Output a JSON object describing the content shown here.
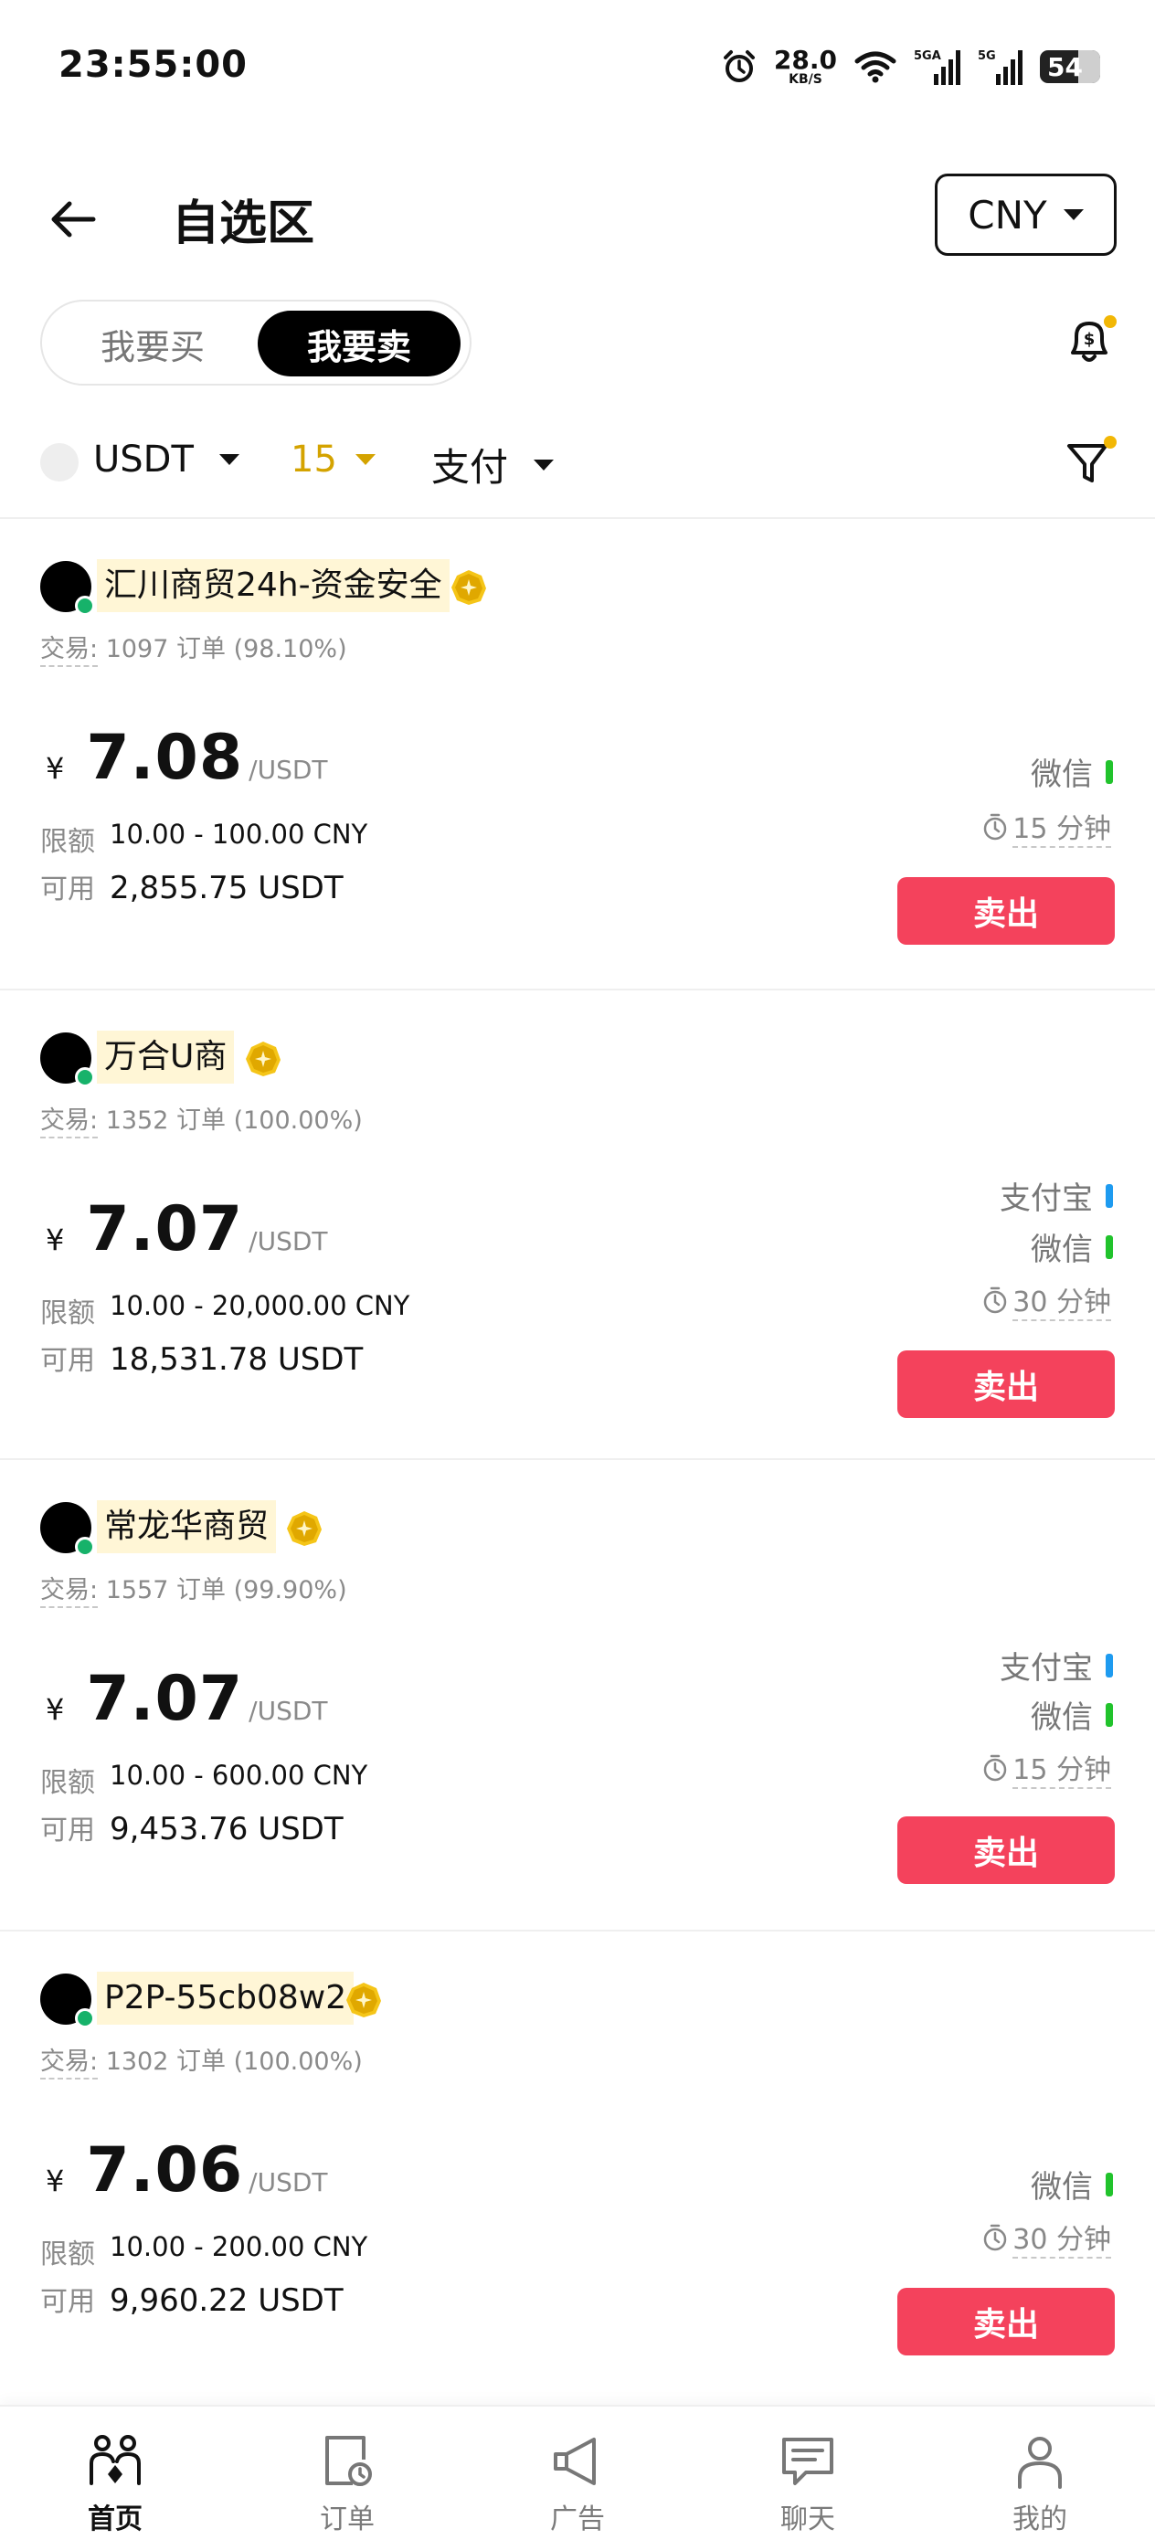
{
  "status_bar": {
    "time": "23:55:00",
    "net_speed_value": "28.0",
    "net_speed_unit": "KB/S",
    "sim1_label": "5GA",
    "sim2_label": "5G",
    "battery": "54"
  },
  "header": {
    "title": "自选区",
    "currency": "CNY"
  },
  "toggle": {
    "buy_label": "我要买",
    "sell_label": "我要卖",
    "selected": "我要卖"
  },
  "filters": {
    "coin": "USDT",
    "amount": "15",
    "payment": "支付"
  },
  "listings": [
    {
      "merchant": "汇川商贸24h-资金安全",
      "stats_label": "交易:",
      "stats_value": "1097 订单 (98.10%)",
      "yen": "¥",
      "price": "7.08",
      "unit": "/USDT",
      "limit_label": "限额",
      "limit_value": "10.00 - 100.00 CNY",
      "available_label": "可用",
      "available_value": "2,855.75 USDT",
      "payment_methods": [
        {
          "name": "微信",
          "color": "#21c32c"
        }
      ],
      "time_limit": "15 分钟",
      "action": "卖出"
    },
    {
      "merchant": "万合U商",
      "stats_label": "交易:",
      "stats_value": "1352 订单 (100.00%)",
      "yen": "¥",
      "price": "7.07",
      "unit": "/USDT",
      "limit_label": "限额",
      "limit_value": "10.00 - 20,000.00 CNY",
      "available_label": "可用",
      "available_value": "18,531.78 USDT",
      "payment_methods": [
        {
          "name": "支付宝",
          "color": "#1e9bf0"
        },
        {
          "name": "微信",
          "color": "#21c32c"
        }
      ],
      "time_limit": "30 分钟",
      "action": "卖出"
    },
    {
      "merchant": "常龙华商贸",
      "stats_label": "交易:",
      "stats_value": "1557 订单 (99.90%)",
      "yen": "¥",
      "price": "7.07",
      "unit": "/USDT",
      "limit_label": "限额",
      "limit_value": "10.00 - 600.00 CNY",
      "available_label": "可用",
      "available_value": "9,453.76 USDT",
      "payment_methods": [
        {
          "name": "支付宝",
          "color": "#1e9bf0"
        },
        {
          "name": "微信",
          "color": "#21c32c"
        }
      ],
      "time_limit": "15 分钟",
      "action": "卖出"
    },
    {
      "merchant": "P2P-55cb08w2",
      "stats_label": "交易:",
      "stats_value": "1302 订单 (100.00%)",
      "yen": "¥",
      "price": "7.06",
      "unit": "/USDT",
      "limit_label": "限额",
      "limit_value": "10.00 - 200.00 CNY",
      "available_label": "可用",
      "available_value": "9,960.22 USDT",
      "payment_methods": [
        {
          "name": "微信",
          "color": "#21c32c"
        }
      ],
      "time_limit": "30 分钟",
      "action": "卖出"
    }
  ],
  "bottom_nav": [
    {
      "label": "首页",
      "icon": "home-people-icon",
      "active": true
    },
    {
      "label": "订单",
      "icon": "orders-icon",
      "active": false
    },
    {
      "label": "广告",
      "icon": "megaphone-icon",
      "active": false
    },
    {
      "label": "聊天",
      "icon": "chat-icon",
      "active": false
    },
    {
      "label": "我的",
      "icon": "profile-icon",
      "active": false
    }
  ],
  "colors": {
    "sell_button": "#f4425c",
    "merchant_highlight": "#fff6d6",
    "filter_accent": "#d4a300",
    "online": "#17b26a"
  }
}
